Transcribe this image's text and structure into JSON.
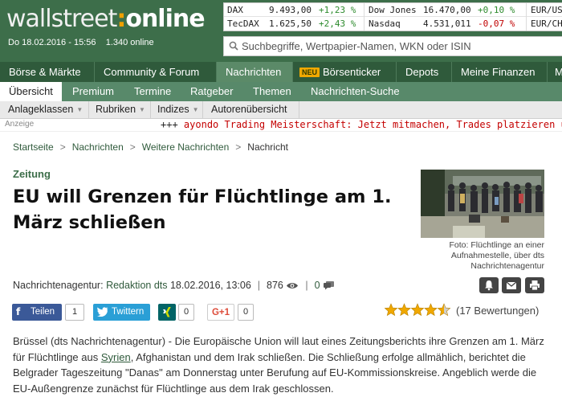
{
  "header": {
    "logo_left": "wallstreet",
    "logo_colon": ":",
    "logo_right": "online",
    "date": "Do 18.02.2016 - 15:56",
    "online": "1.340 online"
  },
  "ticker": [
    {
      "name": "DAX",
      "value": "9.493,00",
      "change": "+1,23 %",
      "dir": "up"
    },
    {
      "name": "Dow Jones",
      "value": "16.470,00",
      "change": "+0,10 %",
      "dir": "up"
    },
    {
      "name": "EUR/US",
      "value": "",
      "change": "",
      "dir": "none"
    },
    {
      "name": "TecDAX",
      "value": "1.625,50",
      "change": "+2,43 %",
      "dir": "up"
    },
    {
      "name": "Nasdaq",
      "value": "4.531,011",
      "change": "-0,07 %",
      "dir": "down"
    },
    {
      "name": "EUR/CH",
      "value": "",
      "change": "",
      "dir": "none"
    }
  ],
  "search": {
    "placeholder": "Suchbegriffe, Wertpapier-Namen, WKN oder ISIN"
  },
  "mainnav": [
    "Börse & Märkte",
    "Community & Forum",
    "Nachrichten",
    "Börsenticker",
    "Depots",
    "Meine Finanzen",
    "M"
  ],
  "mainnav_badge": "NEU",
  "subnav": [
    "Übersicht",
    "Premium",
    "Termine",
    "Ratgeber",
    "Themen",
    "Nachrichten-Suche"
  ],
  "filternav": [
    "Anlageklassen",
    "Rubriken",
    "Indizes",
    "Autorenübersicht"
  ],
  "ad": {
    "label": "Anzeige",
    "prefix": "+++",
    "text": "ayondo Trading Meisterschaft: Jetzt mitmachen, Trades platzieren u"
  },
  "breadcrumb": [
    "Startseite",
    "Nachrichten",
    "Weitere Nachrichten",
    "Nachricht"
  ],
  "article": {
    "kicker": "Zeitung",
    "title": "EU will Grenzen für Flüchtlinge am 1. März schließen",
    "photo_caption": "Foto: Flüchtlinge an einer Aufnahmestelle, über dts Nachrichtenagentur",
    "meta_prefix": "Nachrichtenagentur:",
    "meta_author": "Redaktion dts",
    "meta_date": "18.02.2016, 13:06",
    "views": "876",
    "comments": "0",
    "body_1": "Brüssel (dts Nachrichtenagentur) - Die Europäische Union will laut eines Zeitungsberichts ihre Grenzen am 1. März für Flüchtlinge aus ",
    "body_link": "Syrien",
    "body_2": ", Afghanistan und dem Irak schließen. Die Schließung erfolge allmählich, berichtet die Belgrader Tageszeitung \"Danas\" am Donnerstag unter Berufung auf EU-Kommissionskreise. Angeblich werde die EU-Außengrenze zunächst für Flüchtlinge aus dem Irak geschlossen."
  },
  "social": {
    "facebook_label": "Teilen",
    "facebook_count": "1",
    "twitter_label": "Twittern",
    "xing_count": "0",
    "gplus_label": "G+1",
    "gplus_count": "0"
  },
  "rating": {
    "stars": 4.5,
    "text": "(17 Bewertungen)"
  },
  "colors": {
    "brand_green": "#3d6e4a",
    "nav_dark": "#2f5a3b",
    "ad_red": "#c40000",
    "star": "#f0a800"
  }
}
